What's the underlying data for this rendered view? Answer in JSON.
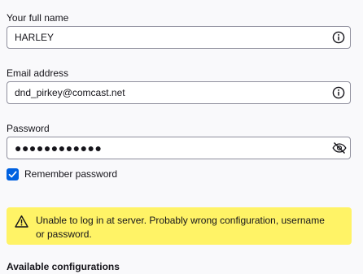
{
  "name_field": {
    "label": "Your full name",
    "value": "HARLEY",
    "icon": "info-icon"
  },
  "email_field": {
    "label": "Email address",
    "value": "dnd_pirkey@comcast.net",
    "icon": "info-icon"
  },
  "password_field": {
    "label": "Password",
    "value": "●●●●●●●●●●●●",
    "icon": "eye-slash-icon"
  },
  "remember": {
    "label": "Remember password",
    "checked": true
  },
  "alert": {
    "icon": "warning-icon",
    "text": "Unable to log in at server. Probably wrong configuration, username or password.",
    "color": "#fff366"
  },
  "configs": {
    "heading": "Available configurations"
  },
  "colors": {
    "accent": "#0061e0",
    "background": "#f9f9fb",
    "warning_bg": "#fff366"
  }
}
